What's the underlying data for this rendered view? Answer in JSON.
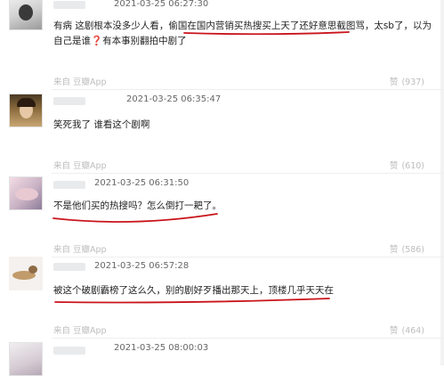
{
  "comments": [
    {
      "time": "2021-03-25 06:27:30",
      "line1": "有病 这剧根本没多少人看，偷国在国内营销买热搜买上天了还好意思截图骂，太sb了，以为",
      "line2": "自己是谁",
      "line2_tail": "有本事别翻拍中剧了",
      "source": "来自 豆瓣App",
      "like_label": "赞",
      "likes": "(937)"
    },
    {
      "time": "2021-03-25 06:35:47",
      "line1": "笑死我了 谁看这个剧啊",
      "source": "来自 豆瓣App",
      "like_label": "赞",
      "likes": "(610)"
    },
    {
      "time": "2021-03-25 06:31:50",
      "line1": "不是他们买的热搜吗？怎么倒打一耙了。",
      "source": "来自 豆瓣App",
      "like_label": "赞",
      "likes": "(586)"
    },
    {
      "time": "2021-03-25 06:57:28",
      "line1": "被这个破剧霸榜了这么久，别的剧好歹播出那天上，顶楼几乎天天在",
      "source": "来自 豆瓣App",
      "like_label": "赞",
      "likes": "(464)"
    },
    {
      "time": "2021-03-25 08:00:03"
    }
  ],
  "colors": {
    "annotation": "#c9141b",
    "meta": "#666666",
    "source": "#bdbdbd"
  }
}
